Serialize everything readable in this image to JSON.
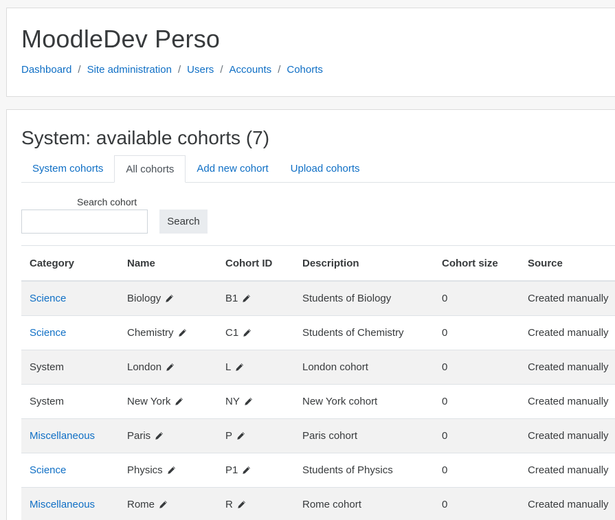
{
  "header": {
    "site_title": "MoodleDev Perso",
    "breadcrumb": [
      "Dashboard",
      "Site administration",
      "Users",
      "Accounts",
      "Cohorts"
    ],
    "breadcrumb_separator": "/"
  },
  "main": {
    "heading": "System: available cohorts (7)",
    "tabs": [
      {
        "label": "System cohorts",
        "active": false
      },
      {
        "label": "All cohorts",
        "active": true
      },
      {
        "label": "Add new cohort",
        "active": false
      },
      {
        "label": "Upload cohorts",
        "active": false
      }
    ],
    "search": {
      "label": "Search cohort",
      "value": "",
      "placeholder": "",
      "button_label": "Search"
    },
    "table": {
      "headers": [
        "Category",
        "Name",
        "Cohort ID",
        "Description",
        "Cohort size",
        "Source"
      ],
      "rows": [
        {
          "category": "Science",
          "category_link": true,
          "name": "Biology",
          "cohort_id": "B1",
          "description": "Students of Biology",
          "size": "0",
          "source": "Created manually"
        },
        {
          "category": "Science",
          "category_link": true,
          "name": "Chemistry",
          "cohort_id": "C1",
          "description": "Students of Chemistry",
          "size": "0",
          "source": "Created manually"
        },
        {
          "category": "System",
          "category_link": false,
          "name": "London",
          "cohort_id": "L",
          "description": "London cohort",
          "size": "0",
          "source": "Created manually"
        },
        {
          "category": "System",
          "category_link": false,
          "name": "New York",
          "cohort_id": "NY",
          "description": "New York cohort",
          "size": "0",
          "source": "Created manually"
        },
        {
          "category": "Miscellaneous",
          "category_link": true,
          "name": "Paris",
          "cohort_id": "P",
          "description": "Paris cohort",
          "size": "0",
          "source": "Created manually"
        },
        {
          "category": "Science",
          "category_link": true,
          "name": "Physics",
          "cohort_id": "P1",
          "description": "Students of Physics",
          "size": "0",
          "source": "Created manually"
        },
        {
          "category": "Miscellaneous",
          "category_link": true,
          "name": "Rome",
          "cohort_id": "R",
          "description": "Rome cohort",
          "size": "0",
          "source": "Created manually"
        }
      ]
    }
  },
  "icons": {
    "edit": "pencil-icon"
  },
  "colors": {
    "link": "#0f6fc5",
    "text": "#373a3c",
    "stripe": "#f2f2f2",
    "page_bg": "#f7f7f7"
  }
}
